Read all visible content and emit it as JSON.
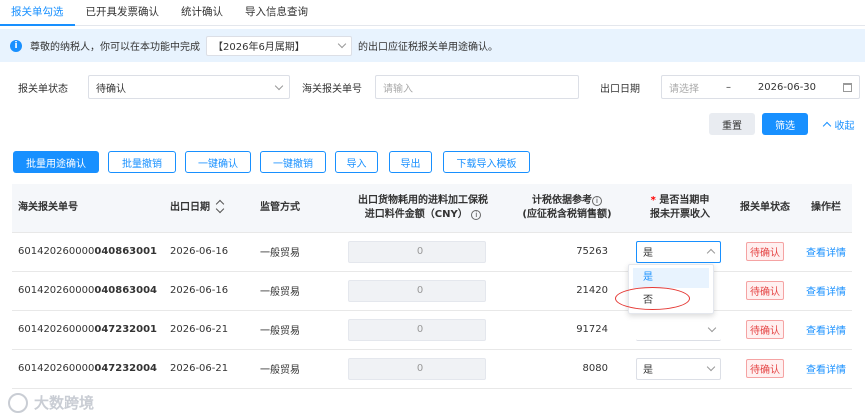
{
  "tabs": [
    "报关单勾选",
    "已开具发票确认",
    "统计确认",
    "导入信息查询"
  ],
  "notice": {
    "prefix": "尊敬的纳税人，你可以在本功能中完成",
    "period": "【2026年6月属期】",
    "suffix": "的出口应征税报关单用途确认。"
  },
  "filters": {
    "status_label": "报关单状态",
    "status_value": "待确认",
    "decl_no_label": "海关报关单号",
    "decl_no_placeholder": "请输入",
    "date_label": "出口日期",
    "date_start_placeholder": "请选择",
    "date_sep": "–",
    "date_end": "2026-06-30"
  },
  "actions": {
    "reset": "重置",
    "search": "筛选",
    "collapse": "收起"
  },
  "toolbar": [
    "批量用途确认",
    "批量撤销",
    "一键确认",
    "一键撤销",
    "导入",
    "导出",
    "下载导入模板"
  ],
  "table": {
    "headers": {
      "decl_no": "海关报关单号",
      "export_date": "出口日期",
      "supervision": "监管方式",
      "amount_line1": "出口货物耗用的进料加工保税",
      "amount_line2": "进口料件金额（CNY）",
      "basis_line1": "计税依据参考",
      "basis_line2": "(应征税含税销售额)",
      "declare_line1": "是否当期申",
      "declare_line2": "报未开票收入",
      "status": "报关单状态",
      "ops": "操作栏"
    },
    "rows": [
      {
        "no_prefix": "601420260000",
        "no_suffix": "040863001",
        "date": "2026-06-16",
        "mode": "一般贸易",
        "amount": "0",
        "basis": "75263",
        "declare": "是",
        "status": "待确认",
        "op": "查看详情"
      },
      {
        "no_prefix": "601420260000",
        "no_suffix": "040863004",
        "date": "2026-06-16",
        "mode": "一般贸易",
        "amount": "0",
        "basis": "21420",
        "declare": "",
        "status": "待确认",
        "op": "查看详情"
      },
      {
        "no_prefix": "601420260000",
        "no_suffix": "047232001",
        "date": "2026-06-21",
        "mode": "一般贸易",
        "amount": "0",
        "basis": "91724",
        "declare": "",
        "status": "待确认",
        "op": "查看详情"
      },
      {
        "no_prefix": "601420260000",
        "no_suffix": "047232004",
        "date": "2026-06-21",
        "mode": "一般贸易",
        "amount": "0",
        "basis": "8080",
        "declare": "是",
        "status": "待确认",
        "op": "查看详情"
      }
    ]
  },
  "dropdown": {
    "options": [
      "是",
      "否"
    ]
  },
  "watermark": "大数跨境",
  "colors": {
    "primary": "#1890ff",
    "danger": "#e54545",
    "notice_bg": "#e8f3fe"
  }
}
